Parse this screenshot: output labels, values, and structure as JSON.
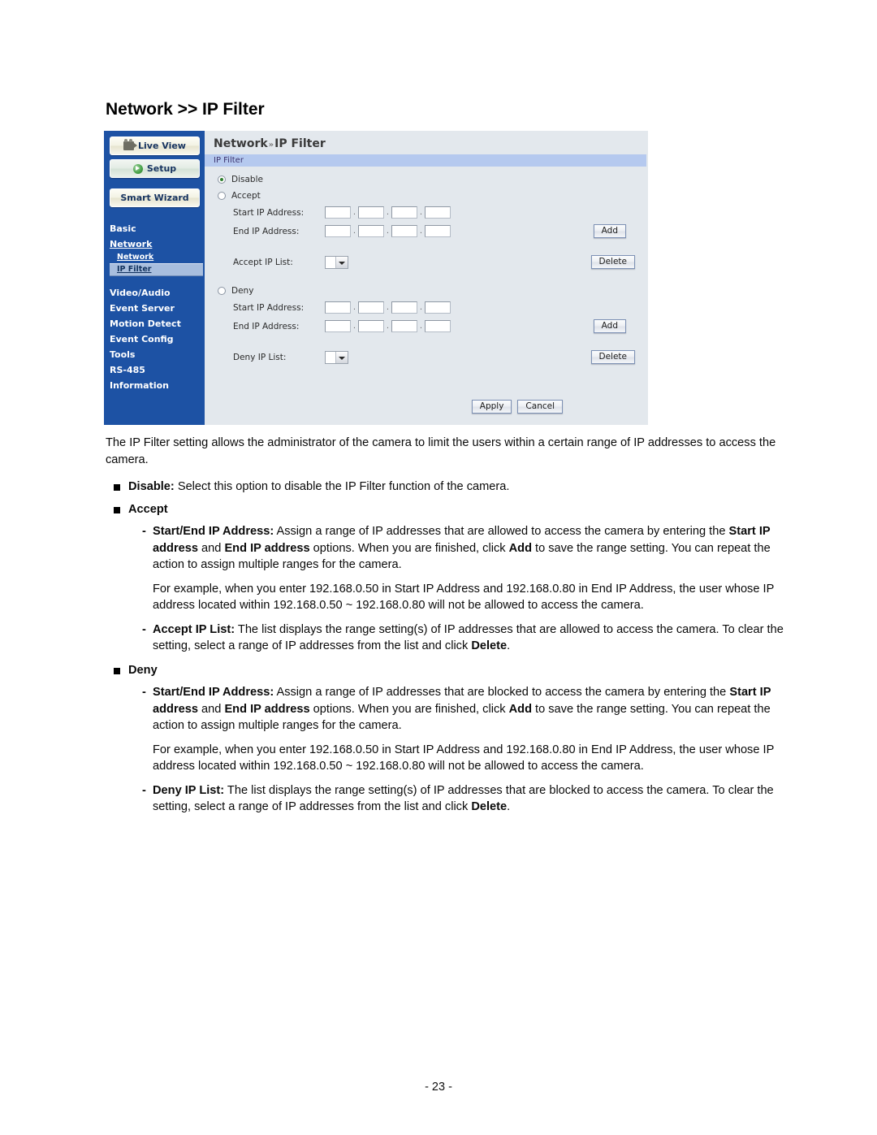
{
  "page": {
    "heading": "Network >> IP Filter",
    "footer": "- 23 -"
  },
  "colors": {
    "sidebar_blue": "#1d52a4",
    "panel_bg": "#e3e8ed",
    "section_bar": "#b5c9ef",
    "active_item": "#a8bede",
    "radio_dot_green": "#2f7f2f"
  },
  "ui": {
    "buttons": {
      "live_view": "Live View",
      "setup": "Setup",
      "smart_wizard": "Smart Wizard"
    },
    "sidebar": {
      "items": [
        {
          "label": "Basic",
          "level": "top",
          "underlined": false,
          "active": false
        },
        {
          "label": "Network",
          "level": "top",
          "underlined": true,
          "active": false
        },
        {
          "label": "Network",
          "level": "sub",
          "underlined": true,
          "active": false
        },
        {
          "label": "IP Filter",
          "level": "sub",
          "underlined": true,
          "active": true
        },
        {
          "label": "Video/Audio",
          "level": "top",
          "underlined": false,
          "active": false
        },
        {
          "label": "Event Server",
          "level": "top",
          "underlined": false,
          "active": false
        },
        {
          "label": "Motion Detect",
          "level": "top",
          "underlined": false,
          "active": false
        },
        {
          "label": "Event Config",
          "level": "top",
          "underlined": false,
          "active": false
        },
        {
          "label": "Tools",
          "level": "top",
          "underlined": false,
          "active": false
        },
        {
          "label": "RS-485",
          "level": "top",
          "underlined": false,
          "active": false
        },
        {
          "label": "Information",
          "level": "top",
          "underlined": false,
          "active": false
        }
      ]
    },
    "breadcrumb": {
      "root": "Network",
      "separator": "»",
      "leaf": "IP Filter"
    },
    "section_title": "IP Filter",
    "options": {
      "disable": {
        "label": "Disable",
        "selected": true
      },
      "accept": {
        "label": "Accept",
        "selected": false
      },
      "deny": {
        "label": "Deny",
        "selected": false
      }
    },
    "accept_group": {
      "start_ip_label": "Start IP Address:",
      "end_ip_label": "End IP Address:",
      "list_label": "Accept IP List:",
      "start_ip": [
        "",
        "",
        "",
        ""
      ],
      "end_ip": [
        "",
        "",
        "",
        ""
      ],
      "list_selected": "",
      "add_label": "Add",
      "delete_label": "Delete"
    },
    "deny_group": {
      "start_ip_label": "Start IP Address:",
      "end_ip_label": "End IP Address:",
      "list_label": "Deny IP List:",
      "start_ip": [
        "",
        "",
        "",
        ""
      ],
      "end_ip": [
        "",
        "",
        "",
        ""
      ],
      "list_selected": "",
      "add_label": "Add",
      "delete_label": "Delete"
    },
    "form_buttons": {
      "apply": "Apply",
      "cancel": "Cancel"
    },
    "separator_dot": "."
  },
  "doc": {
    "intro": "The IP Filter setting allows the administrator of the camera to limit the users within a certain range of IP addresses to access the camera.",
    "disable_head": "Disable:",
    "disable_text": " Select this option to disable the IP Filter function of the camera.",
    "accept_head": "Accept",
    "accept_startend_head": "Start/End IP Address:",
    "accept_startend_text_1": " Assign a range of IP addresses that are allowed to access the camera by entering the ",
    "accept_startend_bold_a": "Start IP address",
    "accept_startend_text_2": " and ",
    "accept_startend_bold_b": "End IP address",
    "accept_startend_text_3": " options. When you are finished, click ",
    "accept_startend_bold_c": "Add",
    "accept_startend_text_4": " to save the range setting. You can repeat the action to assign multiple ranges for the camera.",
    "accept_example": "For example, when you enter 192.168.0.50 in Start IP Address and 192.168.0.80 in End IP Address, the user whose IP address located within 192.168.0.50 ~ 192.168.0.80 will not be allowed to access the camera.",
    "accept_list_head": "Accept IP List:",
    "accept_list_text_1": " The list displays the range setting(s) of IP addresses that are allowed to access the camera. To clear the setting, select a range of IP addresses from the list and click ",
    "accept_list_bold": "Delete",
    "accept_list_text_2": ".",
    "deny_head": "Deny",
    "deny_startend_head": "Start/End IP Address:",
    "deny_startend_text_1": " Assign a range of IP addresses that are blocked to access the camera by entering the ",
    "deny_startend_bold_a": "Start IP address",
    "deny_startend_text_2": " and ",
    "deny_startend_bold_b": "End IP address",
    "deny_startend_text_3": " options. When you are finished, click ",
    "deny_startend_bold_c": "Add",
    "deny_startend_text_4": " to save the range setting. You can repeat the action to assign multiple ranges for the camera.",
    "deny_example": "For example, when you enter 192.168.0.50 in Start IP Address and 192.168.0.80 in End IP Address, the user whose IP address located within 192.168.0.50 ~ 192.168.0.80 will not be allowed to access the camera.",
    "deny_list_head": "Deny IP List:",
    "deny_list_text_1": " The list displays the range setting(s) of IP addresses that are blocked to access the camera. To clear the setting, select a range of IP addresses from the list and click ",
    "deny_list_bold": "Delete",
    "deny_list_text_2": "."
  }
}
